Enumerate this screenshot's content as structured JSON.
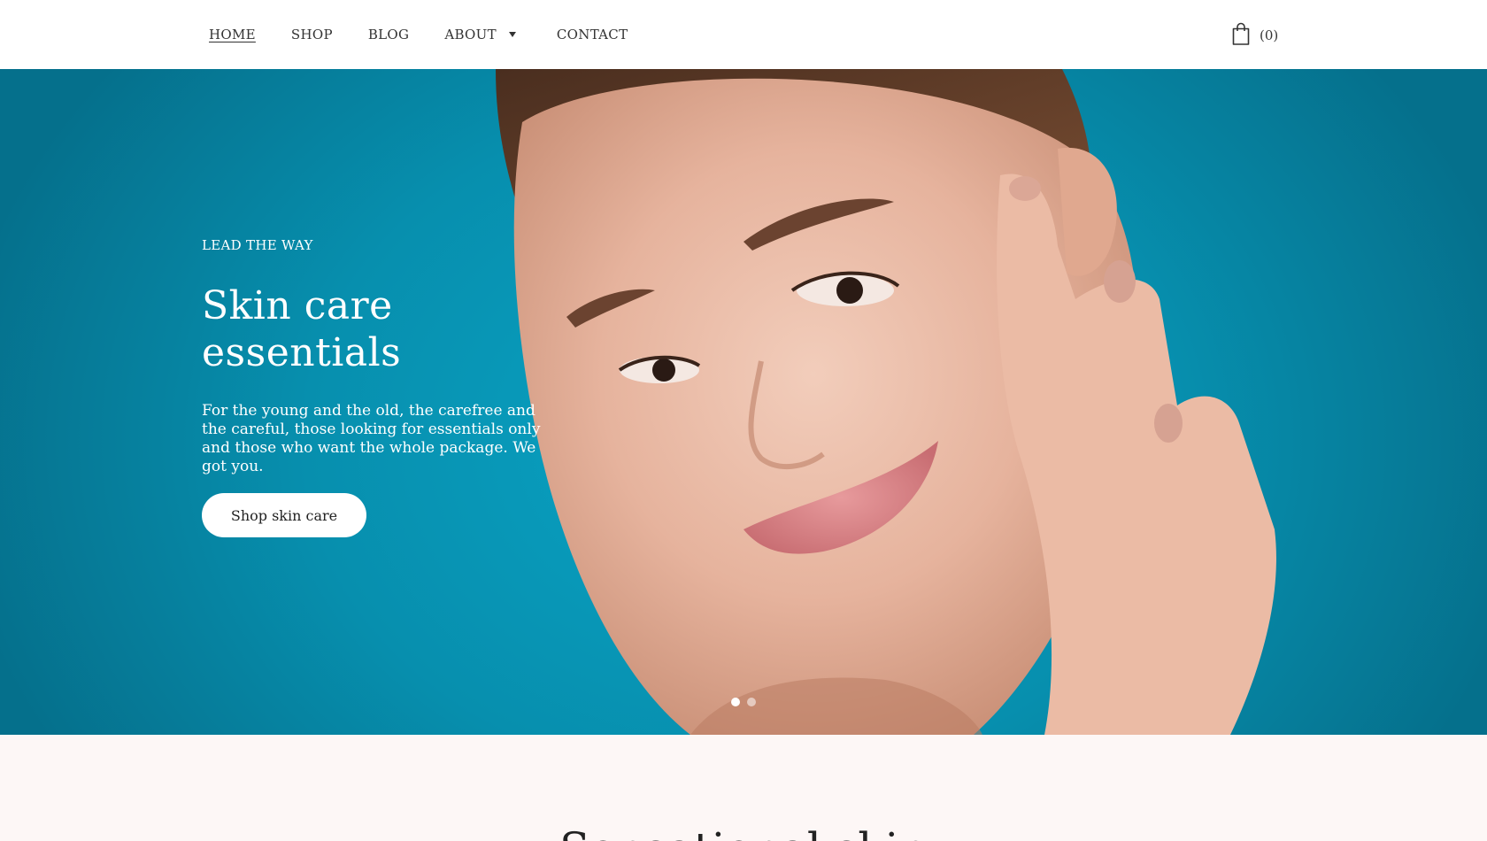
{
  "nav": {
    "items": [
      {
        "label": "HOME",
        "active": true
      },
      {
        "label": "SHOP"
      },
      {
        "label": "BLOG"
      },
      {
        "label": "ABOUT"
      },
      {
        "label": "CONTACT"
      }
    ]
  },
  "cart": {
    "count": "(0)",
    "icon": "shopping-bag-icon"
  },
  "hero": {
    "eyebrow": "LEAD THE WAY",
    "title": "Skin care essentials",
    "description": "For the young and the old, the carefree and the careful, those looking for essentials only and those who want the whole package. We got you.",
    "button_label": "Shop skin care",
    "slides": {
      "count": 2,
      "active_index": 0
    },
    "colors": {
      "background": "#0798b8",
      "text": "#ffffff"
    }
  },
  "section": {
    "title": "Sensational skin",
    "background": "#fdf7f6"
  }
}
